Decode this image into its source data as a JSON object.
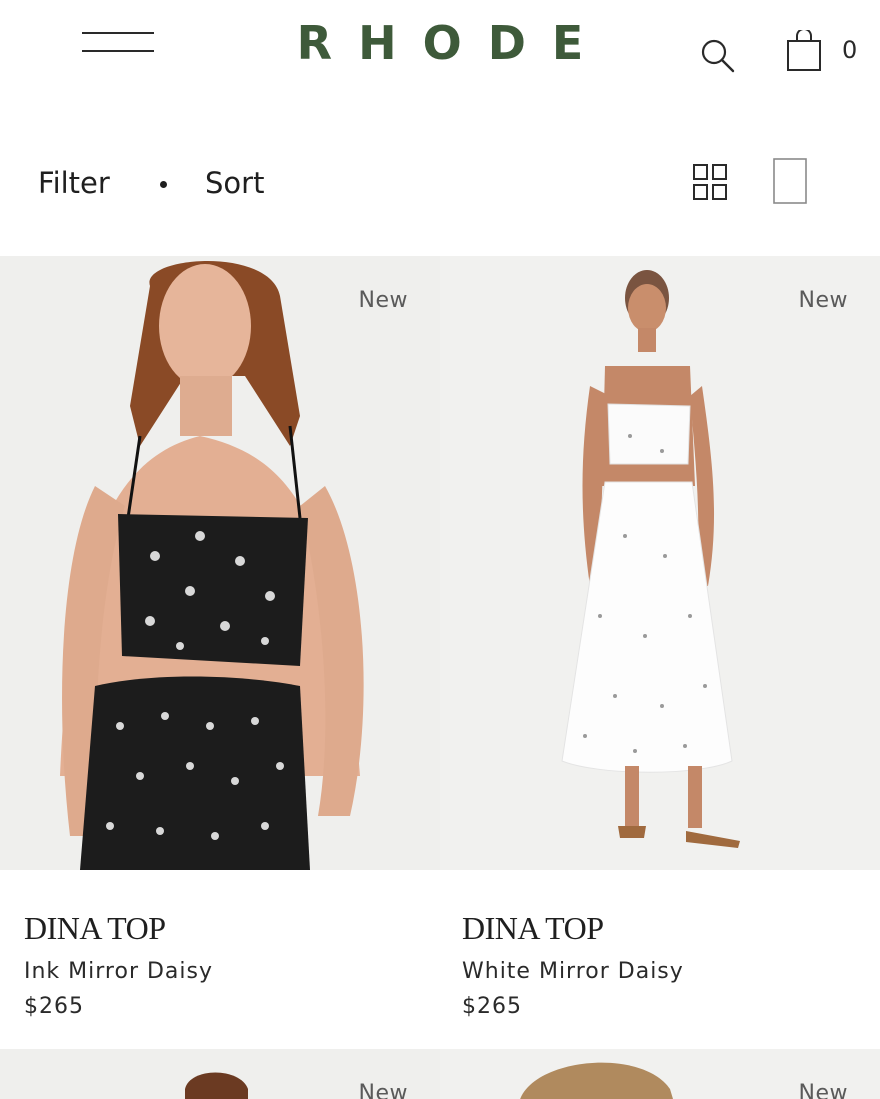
{
  "header": {
    "logo": "RHODE",
    "cart_count": "0"
  },
  "toolbar": {
    "filter_label": "Filter",
    "sort_label": "Sort"
  },
  "products": [
    {
      "badge": "New",
      "name": "DINA TOP",
      "variant": "Ink Mirror Daisy",
      "price": "$265",
      "colorway": "black"
    },
    {
      "badge": "New",
      "name": "DINA TOP",
      "variant": "White Mirror Daisy",
      "price": "$265",
      "colorway": "white"
    },
    {
      "badge": "New"
    },
    {
      "badge": "New"
    }
  ],
  "icons": {
    "menu": "hamburger-menu-icon",
    "search": "search-icon",
    "cart": "shopping-bag-icon",
    "grid_view": "grid-view-icon",
    "single_view": "single-view-icon"
  },
  "colors": {
    "brand": "#3e5a3a",
    "text": "#1f1f1f",
    "badge_text": "#5a5a5a",
    "photo_bg": "#f0f0ee"
  }
}
